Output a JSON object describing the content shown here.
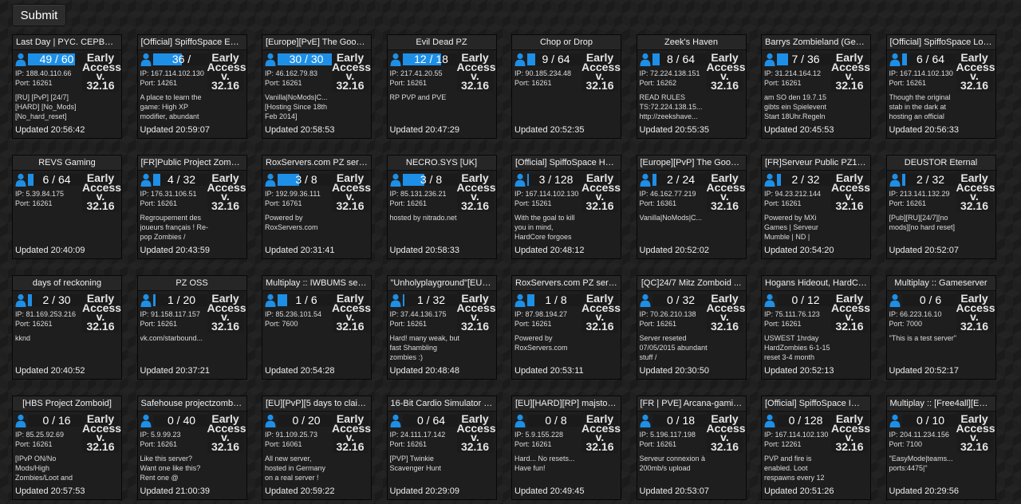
{
  "submit_label": "Submit",
  "accent_color": "#1e8fe6",
  "servers": [
    {
      "title": "Last Day | PYC. CEPBEP | ...",
      "players": "49 / 60",
      "fill": 0.817,
      "ip_label": "IP: 188.40.110.66",
      "port_label": "Port: 16261",
      "description": "[RU] [PvP] [24/7] [HARD] [No_Mods] [No_hard_reset]",
      "early": "Early",
      "access": "Access",
      "v": "v.",
      "version": "32.16",
      "updated": "Updated 20:56:42"
    },
    {
      "title": "[Official] SpiffoSpace Easy...",
      "players": "36 /",
      "fill": 0.5,
      "ip_label": "IP: 167.114.102.130",
      "port_label": "Port: 14261",
      "description": "A place to learn the game: High XP modifier, abundant",
      "early": "Early",
      "access": "Access",
      "v": "v.",
      "version": "32.16",
      "updated": "Updated 20:59:07"
    },
    {
      "title": "[Europe][PvE] The Good O...",
      "players": "30 / 30",
      "fill": 1.0,
      "ip_label": "IP: 46.162.79.83",
      "port_label": "Port: 16261",
      "description": "Vanilla|NoMods|C... [Hosting Since 18th Feb 2014]",
      "early": "Early",
      "access": "Access",
      "v": "v.",
      "version": "32.16",
      "updated": "Updated 20:58:53"
    },
    {
      "title": "Evil Dead PZ",
      "players": "12 / 18",
      "fill": 0.667,
      "ip_label": "IP: 217.41.20.55",
      "port_label": "Port: 16261",
      "description": "RP PVP and PVE",
      "early": "Early",
      "access": "Access",
      "v": "v.",
      "version": "32.16",
      "updated": "Updated 20:47:29"
    },
    {
      "title": "Chop or Drop",
      "players": "9 / 64",
      "fill": 0.14,
      "ip_label": "IP: 90.185.234.48",
      "port_label": "Port: 16261",
      "description": "",
      "early": "Early",
      "access": "Access",
      "v": "v.",
      "version": "32.16",
      "updated": "Updated 20:52:35"
    },
    {
      "title": "Zeek's Haven",
      "players": "8 / 64",
      "fill": 0.125,
      "ip_label": "IP: 72.224.138.151",
      "port_label": "Port: 16262",
      "description": "READ RULES TS:72.224.138.15... http://zeekshave...",
      "early": "Early",
      "access": "Access",
      "v": "v.",
      "version": "32.16",
      "updated": "Updated 20:55:35"
    },
    {
      "title": "Barrys Zombieland (Germ...",
      "players": "7 / 36",
      "fill": 0.194,
      "ip_label": "IP: 31.214.164.12",
      "port_label": "Port: 16261",
      "description": "am SO den 19.7.15 gibts ein Spielevent Start 18Uhr.Regeln",
      "early": "Early",
      "access": "Access",
      "v": "v.",
      "version": "32.16",
      "updated": "Updated 20:45:53"
    },
    {
      "title": "[Official] SpiffoSpace Lon...",
      "players": "6 / 64",
      "fill": 0.094,
      "ip_label": "IP: 167.114.102.130",
      "port_label": "Port: 16261",
      "description": "Though the original stab in the dark at hosting an official",
      "early": "Early",
      "access": "Access",
      "v": "v.",
      "version": "32.16",
      "updated": "Updated 20:56:33"
    },
    {
      "title": "REVS Gaming",
      "players": "6 / 64",
      "fill": 0.094,
      "ip_label": "IP: 5.39.84.175",
      "port_label": "Port: 16261",
      "description": "",
      "early": "Early",
      "access": "Access",
      "v": "v.",
      "version": "32.16",
      "updated": "Updated 20:40:09"
    },
    {
      "title": "[FR]Public Project Zomboi...",
      "players": "4 / 32",
      "fill": 0.125,
      "ip_label": "IP: 176.31.106.51",
      "port_label": "Port: 16261",
      "description": "Regroupement des joueurs français ! Re-pop Zombies /",
      "early": "Early",
      "access": "Access",
      "v": "v.",
      "version": "32.16",
      "updated": "Updated 20:43:59"
    },
    {
      "title": "RoxServers.com PZ server",
      "players": "3 / 8",
      "fill": 0.375,
      "ip_label": "IP: 192.99.36.111",
      "port_label": "Port: 16761",
      "description": "Powered by RoxServers.com",
      "early": "Early",
      "access": "Access",
      "v": "v.",
      "version": "32.16",
      "updated": "Updated 20:31:41"
    },
    {
      "title": "NECRO.SYS [UK]",
      "players": "3 / 8",
      "fill": 0.375,
      "ip_label": "IP: 85.131.236.21",
      "port_label": "Port: 16261",
      "description": "hosted by nitrado.net",
      "early": "Early",
      "access": "Access",
      "v": "v.",
      "version": "32.16",
      "updated": "Updated 20:58:33"
    },
    {
      "title": "[Official] SpiffoSpace Har...",
      "players": "3 / 128",
      "fill": 0.023,
      "ip_label": "IP: 167.114.102.130",
      "port_label": "Port: 15261",
      "description": "With the goal to kill you in mind, HardCore forgoes",
      "early": "Early",
      "access": "Access",
      "v": "v.",
      "version": "32.16",
      "updated": "Updated 20:48:12"
    },
    {
      "title": "[Europe][PvP] The Good O...",
      "players": "2 / 24",
      "fill": 0.083,
      "ip_label": "IP: 46.162.77.219",
      "port_label": "Port: 16361",
      "description": "Vanilla|NoMods|C...",
      "early": "Early",
      "access": "Access",
      "v": "v.",
      "version": "32.16",
      "updated": "Updated 20:52:02"
    },
    {
      "title": "[FR]Serveur Public PZ1 | N...",
      "players": "2 / 32",
      "fill": 0.063,
      "ip_label": "IP: 94.23.212.144",
      "port_label": "Port: 16261",
      "description": "Powered by MXi Games | Serveur Mumble | ND |",
      "early": "Early",
      "access": "Access",
      "v": "v.",
      "version": "32.16",
      "updated": "Updated 20:54:20"
    },
    {
      "title": "DEUSTOR Eternal",
      "players": "2 / 32",
      "fill": 0.063,
      "ip_label": "IP: 213.141.132.29",
      "port_label": "Port: 16261",
      "description": "[Pub][RU][24/7][no mods][no hard reset]",
      "early": "Early",
      "access": "Access",
      "v": "v.",
      "version": "32.16",
      "updated": "Updated 20:52:07"
    },
    {
      "title": "days of reckoning",
      "players": "2 / 30",
      "fill": 0.067,
      "ip_label": "IP: 81.169.253.216",
      "port_label": "Port: 16261",
      "description": "kknd",
      "early": "Early",
      "access": "Access",
      "v": "v.",
      "version": "32.16",
      "updated": "Updated 20:40:52"
    },
    {
      "title": "PZ OSS",
      "players": "1 / 20",
      "fill": 0.05,
      "ip_label": "IP: 91.158.117.157",
      "port_label": "Port: 16261",
      "description": "vk.com/starbound...",
      "early": "Early",
      "access": "Access",
      "v": "v.",
      "version": "32.16",
      "updated": "Updated 20:37:21"
    },
    {
      "title": "Multiplay :: IWBUMS server",
      "players": "1 / 6",
      "fill": 0.167,
      "ip_label": "IP: 85.236.101.54",
      "port_label": "Port: 7600",
      "description": "",
      "early": "Early",
      "access": "Access",
      "v": "v.",
      "version": "32.16",
      "updated": "Updated 20:54:28"
    },
    {
      "title": "\"Unholyplayground\"[EU][H...",
      "players": "1 / 32",
      "fill": 0.031,
      "ip_label": "IP: 37.44.136.175",
      "port_label": "Port: 16261",
      "description": "Hard! many weak, but fast Shambling zombies :)",
      "early": "Early",
      "access": "Access",
      "v": "v.",
      "version": "32.16",
      "updated": "Updated 20:48:48"
    },
    {
      "title": "RoxServers.com PZ server",
      "players": "1 / 8",
      "fill": 0.125,
      "ip_label": "IP: 87.98.194.27",
      "port_label": "Port: 16261",
      "description": "Powered by RoxServers.com",
      "early": "Early",
      "access": "Access",
      "v": "v.",
      "version": "32.16",
      "updated": "Updated 20:53:11"
    },
    {
      "title": "[QC]24/7 Mitz Zomboid ...",
      "players": "0 / 32",
      "fill": 0,
      "ip_label": "IP: 70.26.210.138",
      "port_label": "Port: 16261",
      "description": "Server reseted 07/05/2015 abundant stuff /",
      "early": "Early",
      "access": "Access",
      "v": "v.",
      "version": "32.16",
      "updated": "Updated 20:30:50"
    },
    {
      "title": "Hogans Hideout, HardCor...",
      "players": "0 / 12",
      "fill": 0,
      "ip_label": "IP: 75.111.76.123",
      "port_label": "Port: 16261",
      "description": "USWEST 1hrday HardZombies 6-1-15 reset 3-4 month",
      "early": "Early",
      "access": "Access",
      "v": "v.",
      "version": "32.16",
      "updated": "Updated 20:52:13"
    },
    {
      "title": "Multiplay :: Gameserver",
      "players": "0 / 6",
      "fill": 0,
      "ip_label": "IP: 66.223.16.10",
      "port_label": "Port: 7000",
      "description": "\"This is a test server\"",
      "early": "Early",
      "access": "Access",
      "v": "v.",
      "version": "32.16",
      "updated": "Updated 20:52:17"
    },
    {
      "title": "[HBS Project Zomboid]",
      "players": "0 / 16",
      "fill": 0,
      "ip_label": "IP: 85.25.92.69",
      "port_label": "Port: 16261",
      "description": "[IPvP ON/No Mods/High Zombies/Loot and",
      "early": "Early",
      "access": "Access",
      "v": "v.",
      "version": "32.16",
      "updated": "Updated 20:57:53"
    },
    {
      "title": "Safehouse projectzomboi...",
      "players": "0 / 40",
      "fill": 0,
      "ip_label": "IP: 5.9.99.23",
      "port_label": "Port: 16261",
      "description": "Like this server? Want one like this? Rent one @",
      "early": "Early",
      "access": "Access",
      "v": "v.",
      "version": "32.16",
      "updated": "Updated 21:00:39"
    },
    {
      "title": "[EU][PvP][5 days to claim ...",
      "players": "0 / 20",
      "fill": 0,
      "ip_label": "IP: 91.109.25.73",
      "port_label": "Port: 16061",
      "description": "All new server, hosted in Germany on a real server !",
      "early": "Early",
      "access": "Access",
      "v": "v.",
      "version": "32.16",
      "updated": "Updated 20:59:22"
    },
    {
      "title": "16-Bit Cardio Simulator -...",
      "players": "0 / 64",
      "fill": 0,
      "ip_label": "IP: 24.111.17.142",
      "port_label": "Port: 16261",
      "description": "[PVP] Twinkie Scavenger Hunt",
      "early": "Early",
      "access": "Access",
      "v": "v.",
      "version": "32.16",
      "updated": "Updated 20:29:09"
    },
    {
      "title": "[EU][HARD][RP] majstor's ...",
      "players": "0 / 8",
      "fill": 0,
      "ip_label": "IP: 5.9.155.228",
      "port_label": "Port: 16261",
      "description": "Hard... No resets... Have fun!",
      "early": "Early",
      "access": "Access",
      "v": "v.",
      "version": "32.16",
      "updated": "Updated 20:49:45"
    },
    {
      "title": "[FR | PVE] Arcana-gaming...",
      "players": "0 / 18",
      "fill": 0,
      "ip_label": "IP: 5.196.117.198",
      "port_label": "Port: 16261",
      "description": "Serveur connexion à 200mb/s upload",
      "early": "Early",
      "access": "Access",
      "v": "v.",
      "version": "32.16",
      "updated": "Updated 20:53:07"
    },
    {
      "title": "[Official] SpiffoSpace IWB...",
      "players": "0 / 128",
      "fill": 0,
      "ip_label": "IP: 167.114.102.130",
      "port_label": "Port: 12261",
      "description": "PVP and fire is enabled. Loot respawns every 12",
      "early": "Early",
      "access": "Access",
      "v": "v.",
      "version": "32.16",
      "updated": "Updated 20:51:26"
    },
    {
      "title": "Multiplay :: [Free4all][EAS...",
      "players": "0 / 10",
      "fill": 0,
      "ip_label": "IP: 204.11.234.156",
      "port_label": "Port: 7100",
      "description": "\"EasyMode|teams... ports:4475|\"",
      "early": "Early",
      "access": "Access",
      "v": "v.",
      "version": "32.16",
      "updated": "Updated 20:29:56"
    }
  ]
}
